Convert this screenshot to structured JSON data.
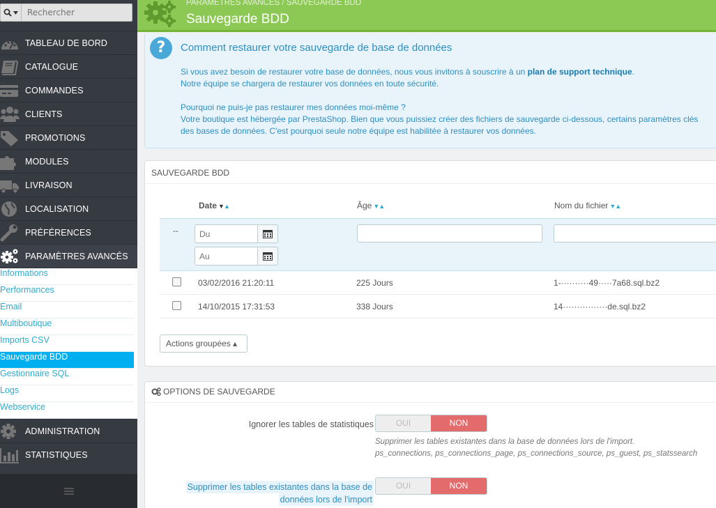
{
  "sidebar": {
    "search_placeholder": "Rechercher",
    "items": [
      {
        "label": "TABLEAU DE BORD",
        "icon": "dashboard-icon"
      },
      {
        "label": "CATALOGUE",
        "icon": "book-icon"
      },
      {
        "label": "COMMANDES",
        "icon": "credit-card-icon"
      },
      {
        "label": "CLIENTS",
        "icon": "users-icon"
      },
      {
        "label": "PROMOTIONS",
        "icon": "tag-icon"
      },
      {
        "label": "MODULES",
        "icon": "puzzle-icon"
      },
      {
        "label": "LIVRAISON",
        "icon": "truck-icon"
      },
      {
        "label": "LOCALISATION",
        "icon": "globe-icon"
      },
      {
        "label": "PRÉFÉRENCES",
        "icon": "wrench-icon"
      },
      {
        "label": "PARAMÈTRES AVANCÉS",
        "icon": "gears-icon"
      }
    ],
    "submenu": [
      "Informations",
      "Performances",
      "Email",
      "Multiboutique",
      "Imports CSV",
      "Sauvegarde BDD",
      "Gestionnaire SQL",
      "Logs",
      "Webservice"
    ],
    "items_after": [
      {
        "label": "ADMINISTRATION",
        "icon": "gear-icon"
      },
      {
        "label": "STATISTIQUES",
        "icon": "bar-chart-icon"
      }
    ]
  },
  "header": {
    "breadcrumb": "PARAMÈTRES AVANCÉS   /   SAUVEGARDE BDD",
    "title": "Sauvegarde BDD"
  },
  "help": {
    "title": "Comment restaurer votre sauvegarde de base de données",
    "line1": "Si vous avez besoin de restaurer votre base de données, nous vous invitons à souscrire à un ",
    "line1_link": "plan de support technique",
    "line1_end": ".",
    "line2": "Notre équipe se chargera de restaurer vos données en toute sécurité.",
    "line3": "Pourquoi ne puis-je pas restaurer mes données moi-même ?",
    "line4": "Votre boutique est hébergée par PrestaShop. Bien que vous puissiez créer des fichiers de sauvegarde ci-dessous, certains paramètres clés",
    "line5": "des bases de données. C'est pourquoi seule notre équipe est habilitée à restaurer vos données."
  },
  "backup": {
    "heading": "SAUVEGARDE BDD",
    "columns": {
      "date": "Date",
      "age": "Âge",
      "filename": "Nom du fichier"
    },
    "filter": {
      "dash": "--",
      "from_placeholder": "Du",
      "to_placeholder": "Au"
    },
    "rows": [
      {
        "date": "03/02/2016 21:20:11",
        "age": "225 Jours",
        "filename": "1-··········49·····7a68.sql.bz2"
      },
      {
        "date": "14/10/2015 17:31:53",
        "age": "338 Jours",
        "filename": "14················de.sql.bz2"
      }
    ],
    "bulk_label": "Actions groupées ▴"
  },
  "options": {
    "heading": "OPTIONS DE SAUVEGARDE",
    "opt1_label": "Ignorer les tables de statistiques",
    "opt1_help1": "Supprimer les tables existantes dans la base de données lors de l'import.",
    "opt1_help2": "ps_connections, ps_connections_page, ps_connections_source, ps_guest, ps_statssearch",
    "opt2_label_l1": "Supprimer les tables existantes dans la base de",
    "opt2_label_l2": "données lors de l'import",
    "yes": "OUI",
    "no": "NON"
  },
  "colors": {
    "header": "#8bc954",
    "sidebar": "#363a41",
    "accent": "#00aff0",
    "danger": "#e36b6b"
  }
}
